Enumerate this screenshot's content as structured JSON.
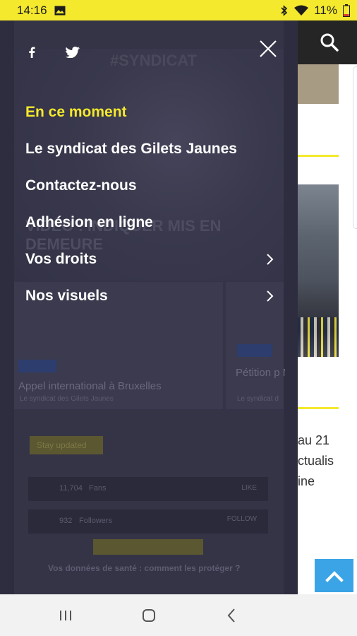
{
  "status": {
    "time": "14:16",
    "battery": "11%"
  },
  "drawer": {
    "menu": [
      {
        "label": "En ce moment",
        "active": true,
        "has_chevron": false
      },
      {
        "label": "Le syndicat des Gilets Jaunes",
        "active": false,
        "has_chevron": false
      },
      {
        "label": "Contactez-nous",
        "active": false,
        "has_chevron": false
      },
      {
        "label": "Adhésion en ligne",
        "active": false,
        "has_chevron": false
      },
      {
        "label": "Vos droits",
        "active": false,
        "has_chevron": true
      },
      {
        "label": "Nos visuels",
        "active": false,
        "has_chevron": true
      }
    ],
    "background": {
      "logo": "#SYNDICAT",
      "hero_title": "VIDÉO : INDIQUER MIS EN DEMEURE",
      "card1_title": "Appel international à Bruxelles",
      "card1_sub": "Le syndicat des Gilets Jaunes",
      "card2_title": "Pétition p Macron",
      "card2_sub": "Le syndicat d",
      "tag": "Stay updated",
      "facebook_count": "11,704",
      "facebook_label": "Fans",
      "facebook_action": "LIKE",
      "twitter_count": "932",
      "twitter_label": "Followers",
      "twitter_action": "FOLLOW",
      "footer_text": "Vos données de santé : comment les protéger ?"
    }
  },
  "page": {
    "snippet_lines": [
      "au 21",
      "ctualis",
      "ine"
    ]
  },
  "colors": {
    "accent": "#f4e92d",
    "drawer": "#2e2d40",
    "scrolltop": "#3aa4e6"
  }
}
